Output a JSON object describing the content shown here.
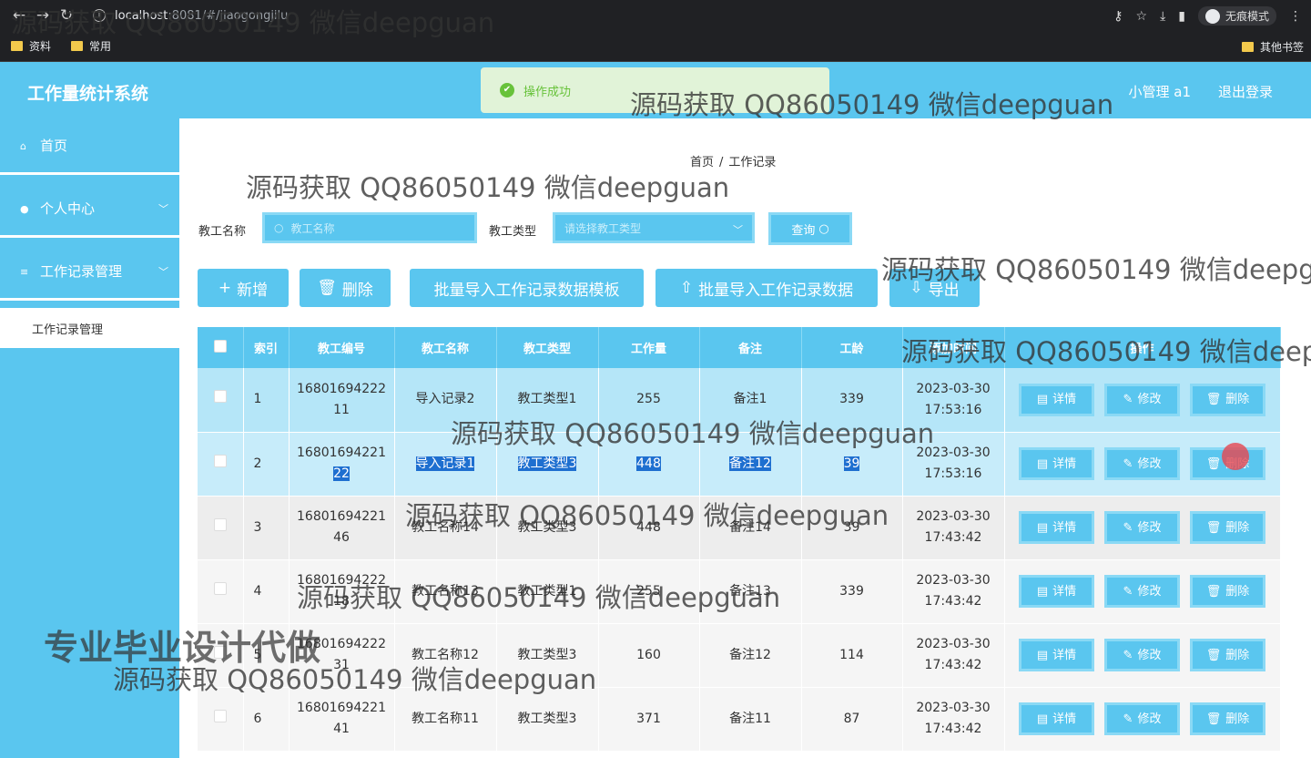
{
  "browser": {
    "url_host": "localhost",
    "url_rest": ":8081/#/jiaogongjilu",
    "incognito_label": "无痕模式",
    "bookmarks": [
      "资料",
      "常用"
    ],
    "other_bookmarks": "其他书签"
  },
  "app": {
    "title": "工作量统计系统",
    "user": "小管理 a1",
    "logout": "退出登录",
    "toast": "操作成功"
  },
  "sidebar": {
    "items": [
      {
        "label": "首页"
      },
      {
        "label": "个人中心"
      },
      {
        "label": "工作记录管理"
      }
    ],
    "sub_item": "工作记录管理"
  },
  "breadcrumb": {
    "home": "首页",
    "sep": "/",
    "current": "工作记录"
  },
  "search": {
    "name_label": "教工名称",
    "name_placeholder": "教工名称",
    "type_label": "教工类型",
    "type_placeholder": "请选择教工类型",
    "query_button": "查询"
  },
  "actions": {
    "add": "新增",
    "delete": "删除",
    "import_template": "批量导入工作记录数据模板",
    "import_data": "批量导入工作记录数据",
    "export": "导出"
  },
  "table": {
    "headers": [
      "索引",
      "教工编号",
      "教工名称",
      "教工类型",
      "工作量",
      "备注",
      "工龄",
      "添加时间",
      "操作"
    ],
    "ops": {
      "detail": "详情",
      "edit": "修改",
      "delete": "删除"
    },
    "rows": [
      {
        "idx": "1",
        "code_a": "16801694222",
        "code_b": "11",
        "name": "导入记录2",
        "type": "教工类型1",
        "workload": "255",
        "remark": "备注1",
        "age": "339",
        "date": "2023-03-30",
        "time": "17:53:16"
      },
      {
        "idx": "2",
        "code_a": "16801694221",
        "code_b": "22",
        "name": "导入记录1",
        "type": "教工类型3",
        "workload": "448",
        "remark": "备注12",
        "age": "39",
        "date": "2023-03-30",
        "time": "17:53:16"
      },
      {
        "idx": "3",
        "code_a": "16801694221",
        "code_b": "46",
        "name": "教工名称14",
        "type": "教工类型3",
        "workload": "448",
        "remark": "备注14",
        "age": "39",
        "date": "2023-03-30",
        "time": "17:43:42"
      },
      {
        "idx": "4",
        "code_a": "16801694222",
        "code_b": "18",
        "name": "教工名称13",
        "type": "教工类型1",
        "workload": "255",
        "remark": "备注13",
        "age": "339",
        "date": "2023-03-30",
        "time": "17:43:42"
      },
      {
        "idx": "5",
        "code_a": "16801694222",
        "code_b": "31",
        "name": "教工名称12",
        "type": "教工类型3",
        "workload": "160",
        "remark": "备注12",
        "age": "114",
        "date": "2023-03-30",
        "time": "17:43:42"
      },
      {
        "idx": "6",
        "code_a": "16801694221",
        "code_b": "41",
        "name": "教工名称11",
        "type": "教工类型3",
        "workload": "371",
        "remark": "备注11",
        "age": "87",
        "date": "2023-03-30",
        "time": "17:43:42"
      }
    ]
  },
  "watermarks": {
    "text": "源码获取 QQ86050149 微信deepguan",
    "text_cut_a": "源码获取 QQ86050149 微信deepg",
    "text_cut_b": "源码获取 QQ86050149 微信deep",
    "banner": "专业毕业设计代做"
  }
}
